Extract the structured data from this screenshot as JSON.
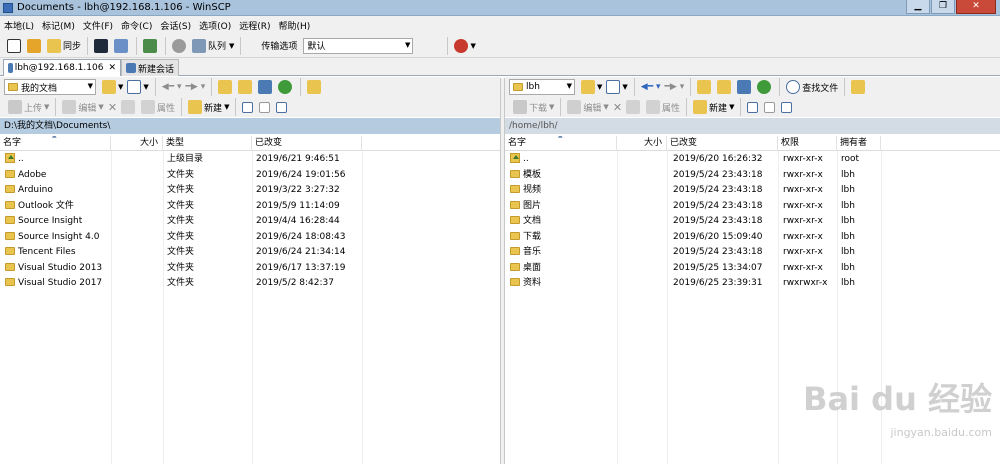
{
  "window": {
    "title": "Documents - lbh@192.168.1.106 - WinSCP"
  },
  "menu": [
    "本地(L)",
    "标记(M)",
    "文件(F)",
    "命令(C)",
    "会话(S)",
    "选项(O)",
    "远程(R)",
    "帮助(H)"
  ],
  "toolbar": {
    "sync": "同步",
    "queue": "队列",
    "transfer_label": "传输选项",
    "transfer_value": "默认"
  },
  "tabs": {
    "session": "lbh@192.168.1.106",
    "close": "✕",
    "new_session": "新建会话"
  },
  "left": {
    "location": "我的文档",
    "buttons": {
      "upload": "上传",
      "edit": "编辑",
      "props": "属性",
      "new": "新建"
    },
    "path": "D:\\我的文档\\Documents\\",
    "columns": [
      "名字",
      "大小",
      "类型",
      "已改变"
    ],
    "rows": [
      {
        "name": "..",
        "type": "上级目录",
        "changed": "2019/6/21 9:46:51"
      },
      {
        "name": "Adobe",
        "type": "文件夹",
        "changed": "2019/6/24 19:01:56"
      },
      {
        "name": "Arduino",
        "type": "文件夹",
        "changed": "2019/3/22 3:27:32"
      },
      {
        "name": "Outlook 文件",
        "type": "文件夹",
        "changed": "2019/5/9 11:14:09"
      },
      {
        "name": "Source Insight",
        "type": "文件夹",
        "changed": "2019/4/4 16:28:44"
      },
      {
        "name": "Source Insight 4.0",
        "type": "文件夹",
        "changed": "2019/6/24 18:08:43"
      },
      {
        "name": "Tencent Files",
        "type": "文件夹",
        "changed": "2019/6/24 21:34:14"
      },
      {
        "name": "Visual Studio 2013",
        "type": "文件夹",
        "changed": "2019/6/17 13:37:19"
      },
      {
        "name": "Visual Studio 2017",
        "type": "文件夹",
        "changed": "2019/5/2 8:42:37"
      }
    ]
  },
  "right": {
    "location": "lbh",
    "find_files": "查找文件",
    "buttons": {
      "download": "下载",
      "edit": "编辑",
      "props": "属性",
      "new": "新建"
    },
    "path": "/home/lbh/",
    "columns": [
      "名字",
      "大小",
      "已改变",
      "权限",
      "拥有者"
    ],
    "rows": [
      {
        "name": "..",
        "changed": "2019/6/20 16:26:32",
        "perm": "rwxr-xr-x",
        "owner": "root"
      },
      {
        "name": "模板",
        "changed": "2019/5/24 23:43:18",
        "perm": "rwxr-xr-x",
        "owner": "lbh"
      },
      {
        "name": "视频",
        "changed": "2019/5/24 23:43:18",
        "perm": "rwxr-xr-x",
        "owner": "lbh"
      },
      {
        "name": "图片",
        "changed": "2019/5/24 23:43:18",
        "perm": "rwxr-xr-x",
        "owner": "lbh"
      },
      {
        "name": "文档",
        "changed": "2019/5/24 23:43:18",
        "perm": "rwxr-xr-x",
        "owner": "lbh"
      },
      {
        "name": "下载",
        "changed": "2019/6/20 15:09:40",
        "perm": "rwxr-xr-x",
        "owner": "lbh"
      },
      {
        "name": "音乐",
        "changed": "2019/5/24 23:43:18",
        "perm": "rwxr-xr-x",
        "owner": "lbh"
      },
      {
        "name": "桌面",
        "changed": "2019/5/25 13:34:07",
        "perm": "rwxr-xr-x",
        "owner": "lbh"
      },
      {
        "name": "资料",
        "changed": "2019/6/25 23:39:31",
        "perm": "rwxrwxr-x",
        "owner": "lbh"
      }
    ]
  },
  "watermark": {
    "main": "Bai du 经验",
    "sub": "jingyan.baidu.com"
  }
}
